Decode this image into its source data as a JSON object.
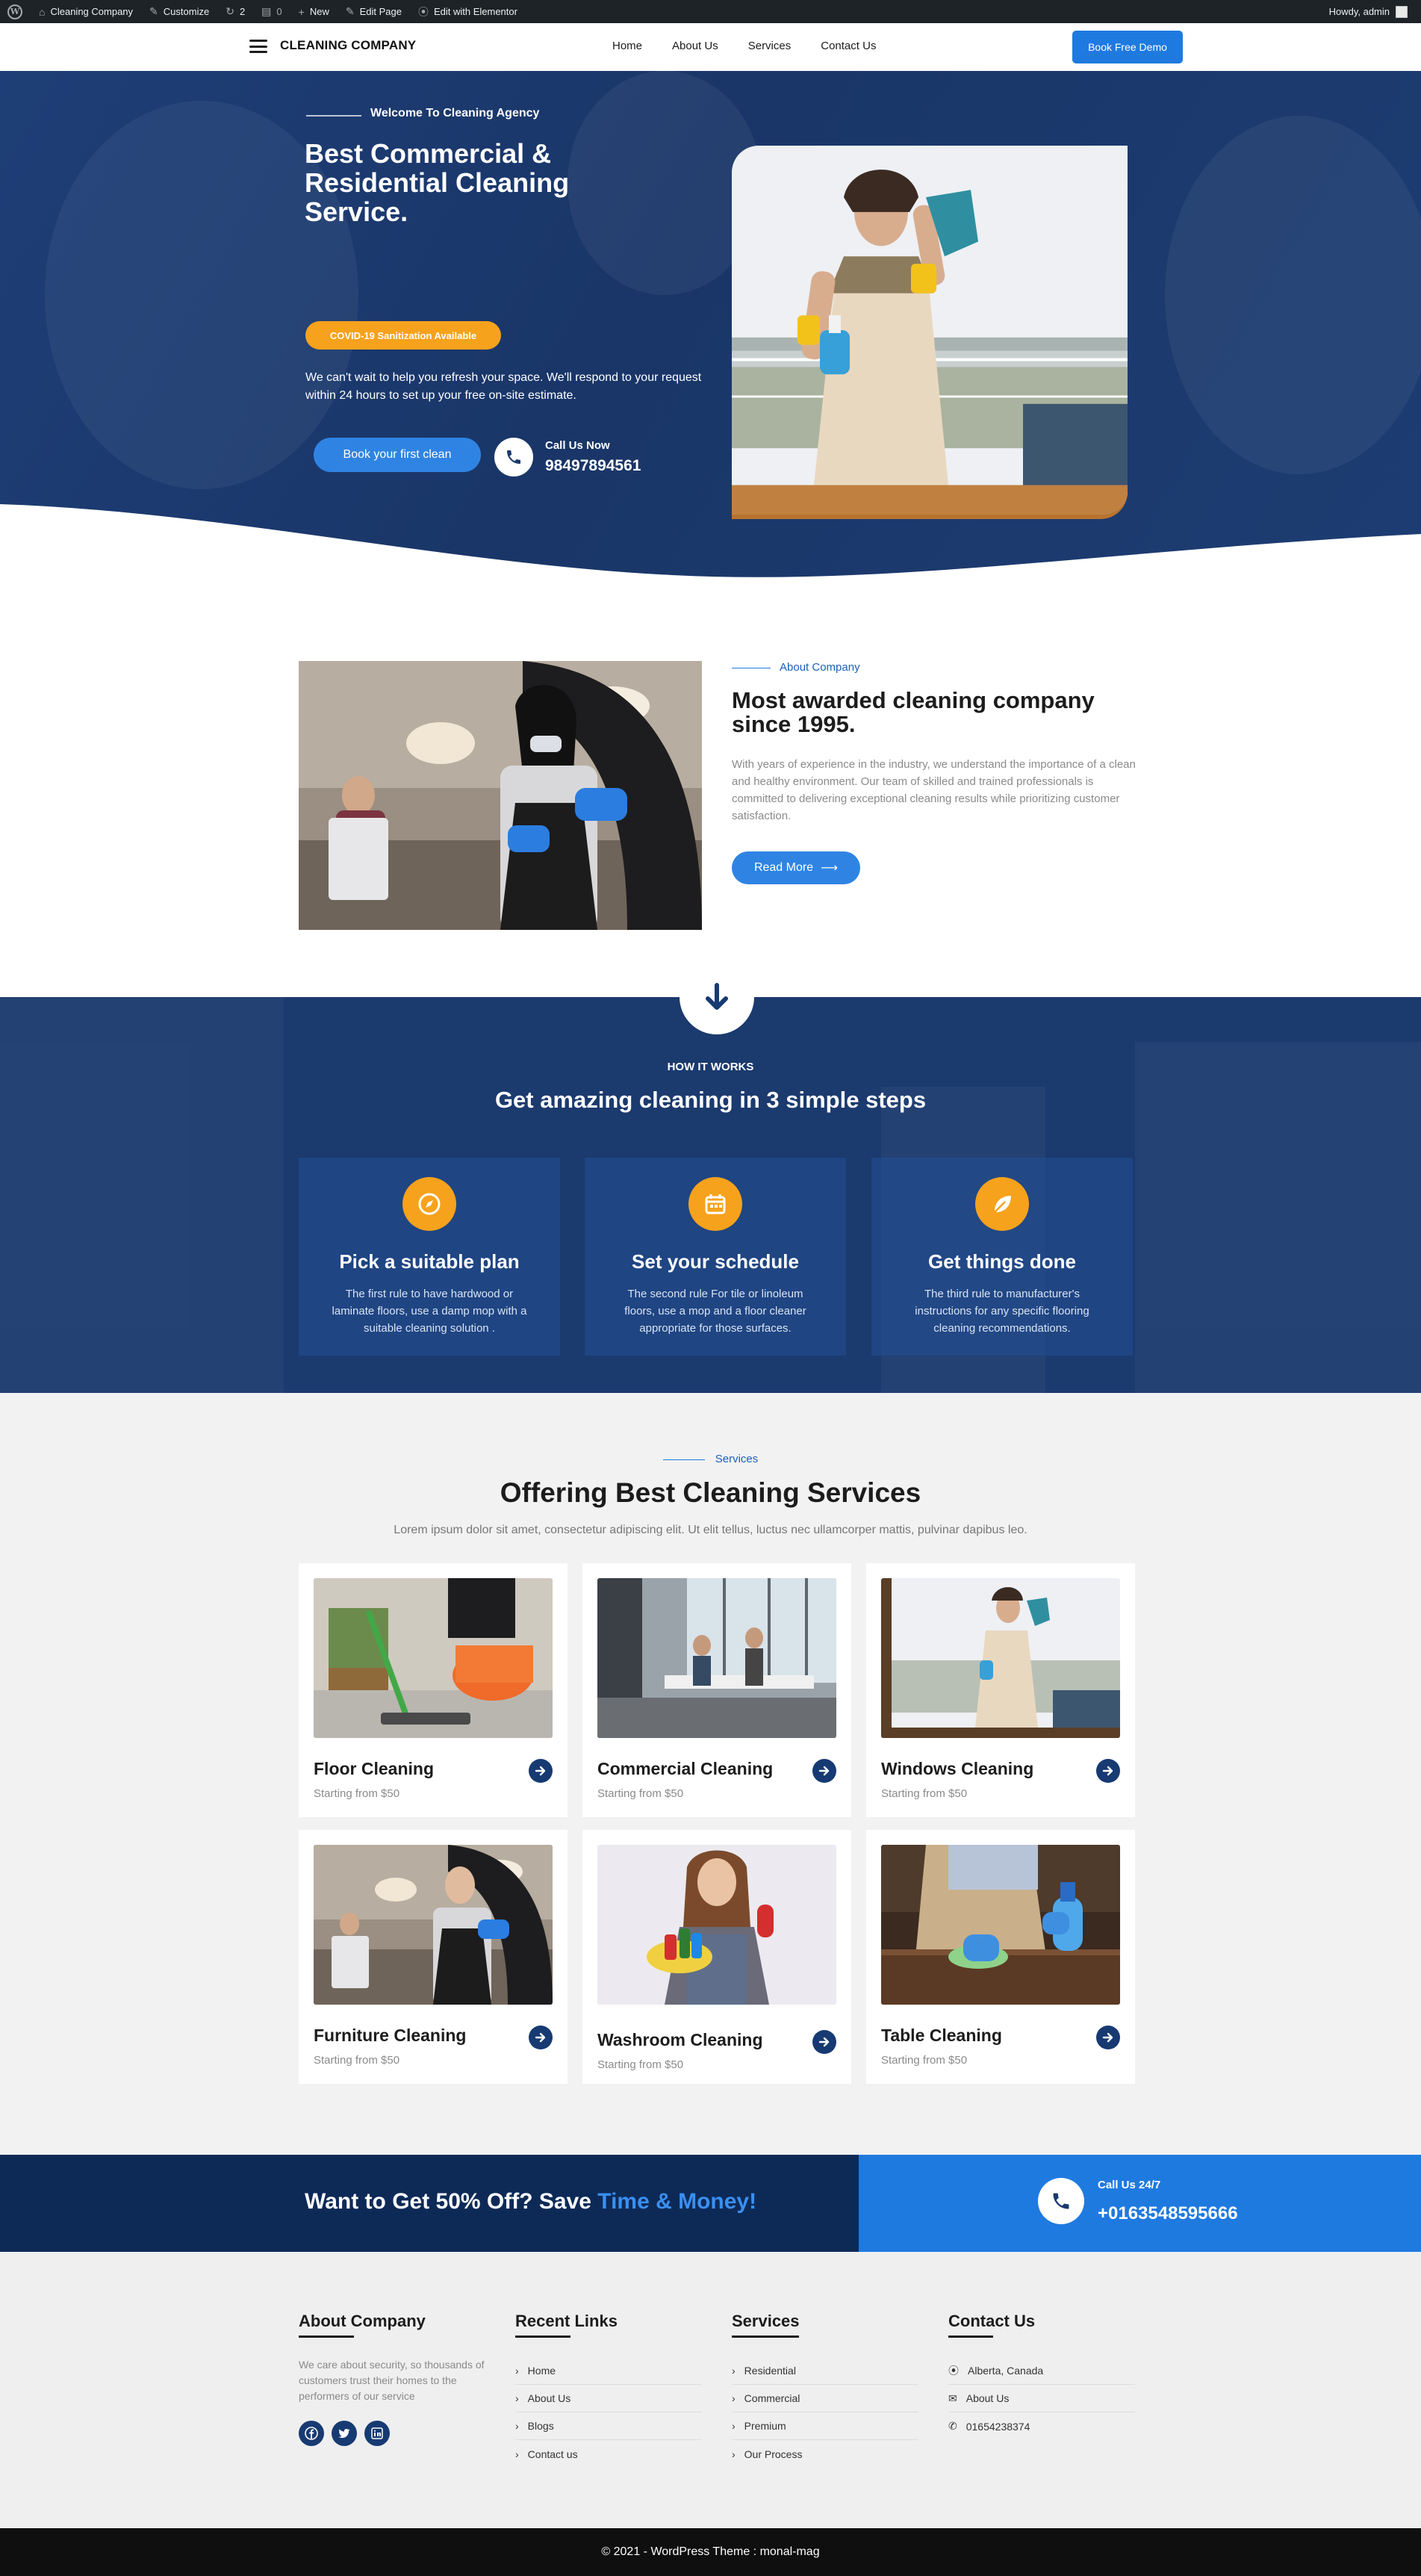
{
  "adminbar": {
    "site": "Cleaning Company",
    "customize": "Customize",
    "updates": "2",
    "comments": "0",
    "new": "New",
    "edit_page": "Edit Page",
    "edit_elementor": "Edit with Elementor",
    "howdy": "Howdy, admin"
  },
  "header": {
    "brand": "CLEANING COMPANY",
    "nav": [
      "Home",
      "About Us",
      "Services",
      "Contact Us"
    ],
    "cta": "Book Free Demo"
  },
  "hero": {
    "kicker": "Welcome To Cleaning Agency",
    "title": "Best Commercial & Residential Cleaning Service.",
    "badge": "COVID-19 Sanitization Available",
    "description": "We can't wait to help you refresh your space. We'll respond to your request within 24 hours to set up your free on-site estimate.",
    "button": "Book your first clean",
    "call_label": "Call Us Now",
    "call_number": "98497894561"
  },
  "about": {
    "kicker": "About Company",
    "title": "Most awarded cleaning company since 1995.",
    "text": "With years of experience in the industry, we understand the importance of a clean and healthy environment. Our team of skilled and trained professionals is committed to delivering exceptional cleaning results while prioritizing customer satisfaction.",
    "button": "Read More"
  },
  "how": {
    "kicker": "HOW IT WORKS",
    "title": "Get amazing cleaning in 3 simple steps",
    "steps": [
      {
        "title": "Pick a suitable plan",
        "text": "The first rule to have hardwood or laminate floors, use a damp mop with a suitable cleaning solution .",
        "icon": "compass-icon"
      },
      {
        "title": "Set your schedule",
        "text": "The second rule For tile or linoleum floors, use a mop and a floor cleaner appropriate for those surfaces.",
        "icon": "calendar-icon"
      },
      {
        "title": "Get things done",
        "text": "The third rule to manufacturer's instructions for any specific flooring cleaning recommendations.",
        "icon": "leaf-icon"
      }
    ]
  },
  "services": {
    "kicker": "Services",
    "title": "Offering Best Cleaning Services",
    "subtitle": "Lorem ipsum dolor sit amet, consectetur adipiscing elit. Ut elit tellus, luctus nec ullamcorper mattis, pulvinar dapibus leo.",
    "items": [
      {
        "name": "Floor Cleaning",
        "price": "Starting from $50"
      },
      {
        "name": "Commercial Cleaning",
        "price": "Starting from $50"
      },
      {
        "name": "Windows Cleaning",
        "price": "Starting from $50"
      },
      {
        "name": "Furniture Cleaning",
        "price": "Starting from $50"
      },
      {
        "name": "Washroom Cleaning",
        "price": "Starting from $50"
      },
      {
        "name": "Table Cleaning",
        "price": "Starting from $50"
      }
    ]
  },
  "promo": {
    "text": "Want to Get 50% Off? Save",
    "accent": "Time & Money!",
    "call_label": "Call Us 24/7",
    "call_number": "+0163548595666"
  },
  "footer": {
    "about_head": "About Company",
    "about_text": "We care about security, so thousands of customers trust their homes to the performers of our service",
    "links_head": "Recent Links",
    "links": [
      "Home",
      "About Us",
      "Blogs",
      "Contact us"
    ],
    "services_head": "Services",
    "services": [
      "Residential",
      "Commercial",
      "Premium",
      "Our Process"
    ],
    "contact_head": "Contact Us",
    "contact": [
      "Alberta, Canada",
      "About Us",
      "01654238374"
    ],
    "copyright": "© 2021 - WordPress Theme : monal-mag"
  },
  "colors": {
    "primary_navy": "#1b3a6e",
    "accent_blue": "#1f7ae0",
    "accent_orange": "#f6a21c",
    "dark_navy": "#0d2a57"
  }
}
